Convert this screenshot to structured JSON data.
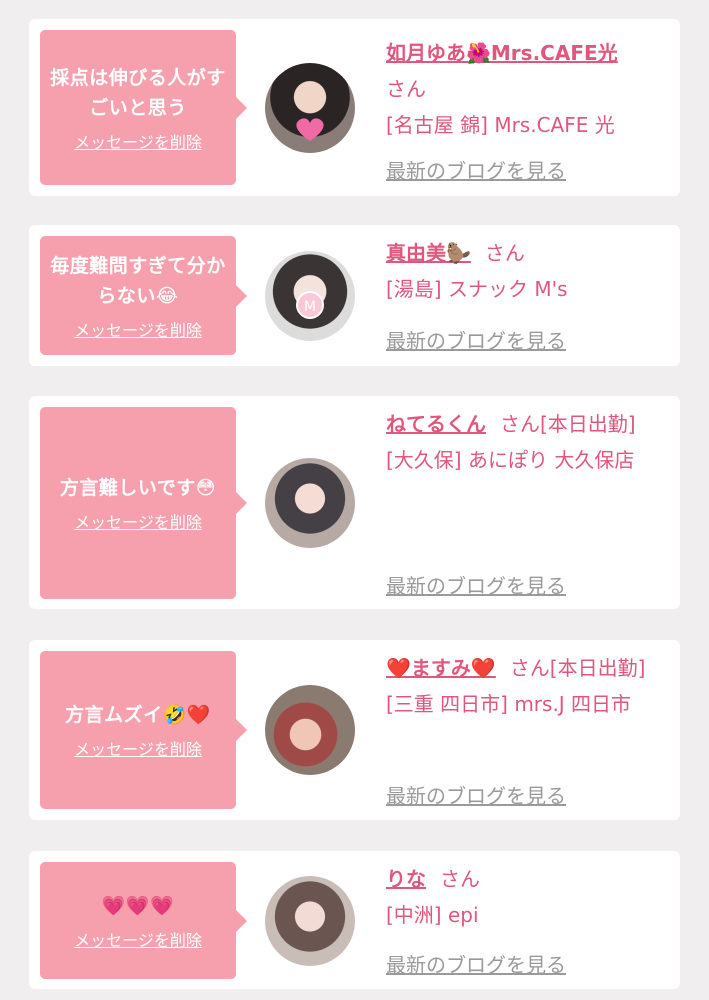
{
  "delete_label": "メッセージを削除",
  "blog_label": "最新のブログを見る",
  "san_label": "さん",
  "entries": [
    {
      "message": "採点は伸びる人がすごいと思う",
      "name": "如月ゆあ🌺Mrs.CAFE光",
      "san": "さん",
      "shop": "[名古屋 錦] Mrs.CAFE 光"
    },
    {
      "message": "毎度難問すぎて分からない😂",
      "name": "真由美🦫",
      "san": "さん",
      "shop": "[湯島] スナック M's"
    },
    {
      "message": "方言難しいです😳",
      "name": "ねてるくん",
      "san": "さん[本日出勤]",
      "shop": "[大久保] あにぽり 大久保店"
    },
    {
      "message": "方言ムズイ🤣❤️",
      "name": "❤️ますみ❤️",
      "san": "さん[本日出勤]",
      "shop": "[三重 四日市] mrs.J 四日市"
    },
    {
      "message": "💗💗💗",
      "name": "りな",
      "san": "さん",
      "shop": "[中洲] epi"
    }
  ],
  "colors": {
    "background": "#f0eeef",
    "bubble": "#f7a0ad",
    "name": "#e0577d",
    "link_gray": "#9a9a9a"
  }
}
